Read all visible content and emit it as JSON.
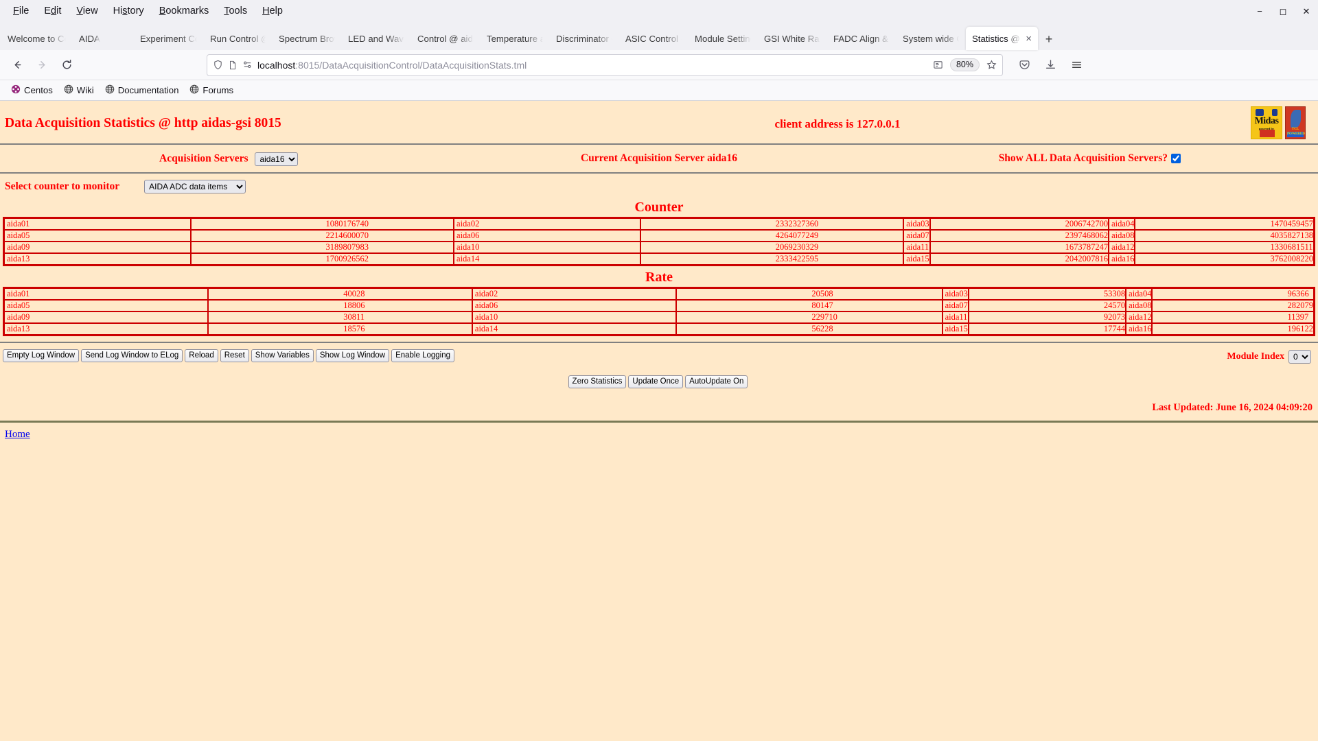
{
  "browser": {
    "menus": [
      "File",
      "Edit",
      "View",
      "History",
      "Bookmarks",
      "Tools",
      "Help"
    ],
    "window_controls": [
      "minimize",
      "maximize",
      "close"
    ],
    "tabs": [
      {
        "label": "Welcome to Cen",
        "active": false
      },
      {
        "label": "AIDA",
        "active": false
      },
      {
        "label": "Experiment Con",
        "active": false
      },
      {
        "label": "Run Control @ a",
        "active": false
      },
      {
        "label": "Spectrum Brows",
        "active": false
      },
      {
        "label": "LED and Wavefo",
        "active": false
      },
      {
        "label": "Control @ aidas",
        "active": false
      },
      {
        "label": "Temperature an",
        "active": false
      },
      {
        "label": "Discriminator co",
        "active": false
      },
      {
        "label": "ASIC Control @",
        "active": false
      },
      {
        "label": "Module Settings",
        "active": false
      },
      {
        "label": "GSI White Rabbi",
        "active": false
      },
      {
        "label": "FADC Align & C",
        "active": false
      },
      {
        "label": "System wide Ch",
        "active": false
      },
      {
        "label": "Statistics @ a",
        "active": true
      }
    ],
    "new_tab_label": "+",
    "url_host": "localhost",
    "url_path": ":8015/DataAcquisitionControl/DataAcquisitionStats.tml",
    "zoom_level": "80%",
    "bookmarks": [
      {
        "label": "Centos",
        "icon": "centos-icon"
      },
      {
        "label": "Wiki",
        "icon": "globe-icon"
      },
      {
        "label": "Documentation",
        "icon": "globe-icon"
      },
      {
        "label": "Forums",
        "icon": "globe-icon"
      }
    ]
  },
  "page": {
    "title": "Data Acquisition Statistics @ http aidas-gsi 8015",
    "client_address": "client address is 127.0.0.1",
    "servers_label": "Acquisition Servers",
    "servers_selected": "aida16",
    "current_server": "Current Acquisition Server aida16",
    "show_all_label": "Show ALL Data Acquisition Servers?",
    "show_all_checked": true,
    "counter_select_label": "Select counter to monitor",
    "counter_selected": "AIDA ADC data items",
    "counter_title": "Counter",
    "rate_title": "Rate",
    "counter_rows": [
      [
        [
          "aida01",
          "1080176740"
        ],
        [
          "aida02",
          "2332327360"
        ],
        [
          "aida03",
          "2006742700"
        ],
        [
          "aida04",
          "1470459457"
        ]
      ],
      [
        [
          "aida05",
          "2214600070"
        ],
        [
          "aida06",
          "4264077249"
        ],
        [
          "aida07",
          "2397468062"
        ],
        [
          "aida08",
          "4035827138"
        ]
      ],
      [
        [
          "aida09",
          "3189807983"
        ],
        [
          "aida10",
          "2069230329"
        ],
        [
          "aida11",
          "1673787247"
        ],
        [
          "aida12",
          "1330681511"
        ]
      ],
      [
        [
          "aida13",
          "1700926562"
        ],
        [
          "aida14",
          "2333422595"
        ],
        [
          "aida15",
          "2042007816"
        ],
        [
          "aida16",
          "3762008220"
        ]
      ]
    ],
    "rate_rows": [
      [
        [
          "aida01",
          "40028"
        ],
        [
          "aida02",
          "20508"
        ],
        [
          "aida03",
          "53308"
        ],
        [
          "aida04",
          "96366"
        ]
      ],
      [
        [
          "aida05",
          "18806"
        ],
        [
          "aida06",
          "80147"
        ],
        [
          "aida07",
          "24570"
        ],
        [
          "aida08",
          "282079"
        ]
      ],
      [
        [
          "aida09",
          "30811"
        ],
        [
          "aida10",
          "229710"
        ],
        [
          "aida11",
          "92073"
        ],
        [
          "aida12",
          "11397"
        ]
      ],
      [
        [
          "aida13",
          "18576"
        ],
        [
          "aida14",
          "56228"
        ],
        [
          "aida15",
          "17744"
        ],
        [
          "aida16",
          "196122"
        ]
      ]
    ],
    "log_buttons": [
      "Empty Log Window",
      "Send Log Window to ELog",
      "Reload",
      "Reset",
      "Show Variables",
      "Show Log Window",
      "Enable Logging"
    ],
    "module_index_label": "Module Index",
    "module_index_value": "0",
    "action_buttons": [
      "Zero Statistics",
      "Update Once",
      "AutoUpdate On"
    ],
    "last_updated": "Last Updated: June 16, 2024 04:09:20",
    "home_link": "Home",
    "colors": {
      "red": "#ff0000",
      "table_border": "#cc0000",
      "page_bg": "#ffe9c9",
      "link": "#0000ee"
    }
  }
}
